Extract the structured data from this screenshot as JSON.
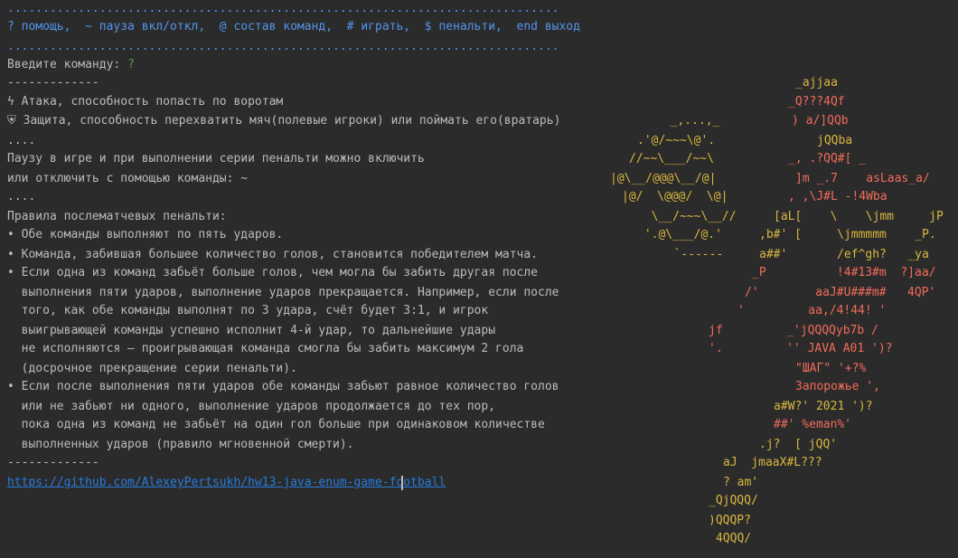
{
  "console": {
    "separator": "..............................................................................",
    "menu_line": "? помощь,  ~ пауза вкл/откл,  @ состав команд,  # играть,  $ пенальти,  end выход",
    "prompt_label": "Введите команду: ",
    "prompt_char": "?",
    "dash_line": "-------------",
    "lines": [
      "ϟ Атака, способность попасть по воротам",
      "⛨ Защита, способность перехватить мяч(полевые игроки) или поймать его(вратарь)",
      "....",
      "Паузу в игре и при выполнении серии пенальти можно включить",
      "или отключить с помощью команды: ~",
      "....",
      "Правила послематчевых пенальти:",
      "• Обе команды выполняют по пять ударов.",
      "• Команда, забившая большее количество голов, становится победителем матча.",
      "• Если одна из команд забьёт больше голов, чем могла бы забить другая после",
      "  выполнения пяти ударов, выполнение ударов прекращается. Например, если после",
      "  того, как обе команды выполнят по 3 удара, счёт будет 3:1, и игрок",
      "  выигрывающей команды успешно исполнит 4-й удар, то дальнейшие удары",
      "  не исполняются — проигрывающая команда смогла бы забить максимум 2 гола",
      "  (досрочное прекращение серии пенальти).",
      "• Если после выполнения пяти ударов обе команды забьют равное количество голов",
      "  или не забьют ни одного, выполнение ударов продолжается до тех пор,",
      "  пока одна из команд не забьёт на один гол больше при одинаковом количестве",
      "  выполненных ударов (правило мгновенной смерти)."
    ],
    "link": "https://github.com/AlexeyPertsukh/hw13-java-enum-game-football"
  },
  "colors": {
    "background": "#2b2b2b",
    "text": "#bbbbbb",
    "menu_blue": "#5394ec",
    "prompt_green": "#4ea33a",
    "link_blue": "#287bde",
    "art_yellow": "#d9b73f",
    "art_red": "#f26b5b"
  },
  "art": {
    "ball": [
      "  _,...,_",
      ".'@/~~~\\@'.",
      "//~~\\___/~~\\",
      "|@\\__/@@@\\__/@|",
      "|@/  \\@@@/  \\@|",
      "  \\__/~~~\\__//",
      " '.@\\___/@.'",
      "   `------"
    ],
    "zaporozhets": [
      {
        "t": "_ajjaa",
        "c": "y"
      },
      {
        "t": "_Q???4Qf",
        "c": "r"
      },
      {
        "t": ") a/]QQb",
        "c": "r"
      },
      {
        "t": "jQQba",
        "c": "y"
      },
      {
        "t": "_, .?QQ#[ _",
        "c": "r"
      },
      {
        "t": "]m _.7    asLaas_a/",
        "c": "r"
      },
      {
        "t": ", ,\\J#L -!4Wba",
        "c": "r"
      },
      {
        "t": "[aL[    \\    \\jmm     jP",
        "c": "y"
      },
      {
        "t": ",b#' [     \\jmmmmm    _P.",
        "c": "y"
      },
      {
        "t": "a##'       /ef^gh?   _ya",
        "c": "y"
      },
      {
        "t": "_P          !4#13#m  ?]aa/",
        "c": "r"
      },
      {
        "t": "/'        aaJ#U###m#   4QP'",
        "c": "r"
      },
      {
        "t": "'         aa,/4!44! '",
        "c": "r"
      },
      {
        "t": "jf         _'jQQQQyb7b /",
        "c": "r"
      },
      {
        "t": "'.         '' JAVA A01 ')?",
        "c": "r"
      },
      {
        "t": "\"ШАГ\" '+?%",
        "c": "r"
      },
      {
        "t": "Запорожье ',",
        "c": "r"
      },
      {
        "t": "a#W?' 2021 ')?",
        "c": "y"
      },
      {
        "t": "##' %eman%'",
        "c": "r"
      },
      {
        "t": ".j?  [ jQQ'",
        "c": "y"
      },
      {
        "t": "aJ  jmaaX#L???",
        "c": "y"
      },
      {
        "t": "? am'",
        "c": "y"
      },
      {
        "t": "_QjQQQ/",
        "c": "y"
      },
      {
        "t": ")QQQP?",
        "c": "y"
      },
      {
        "t": "4QQQ/",
        "c": "y"
      }
    ]
  }
}
